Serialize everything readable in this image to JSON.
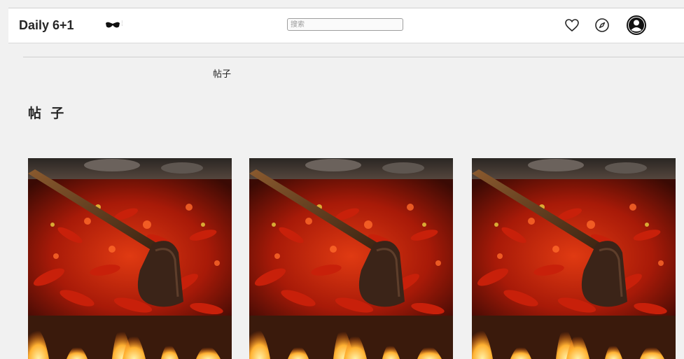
{
  "header": {
    "brand": "Daily 6+1",
    "search_placeholder": "搜索"
  },
  "icons": {
    "brand_mark": "glasses-icon",
    "activity": "heart-icon",
    "explore": "compass-icon",
    "profile": "user-avatar-icon"
  },
  "profile_tabs": {
    "active_label": "帖子"
  },
  "section": {
    "title": "帖 子"
  },
  "posts": [
    {
      "image": "hotpot-chili-ladle-photo"
    },
    {
      "image": "hotpot-chili-ladle-photo"
    },
    {
      "image": "hotpot-chili-ladle-photo"
    }
  ],
  "colors": {
    "page_background": "#f1f1f1",
    "header_background": "#ffffff",
    "text": "#262626"
  }
}
